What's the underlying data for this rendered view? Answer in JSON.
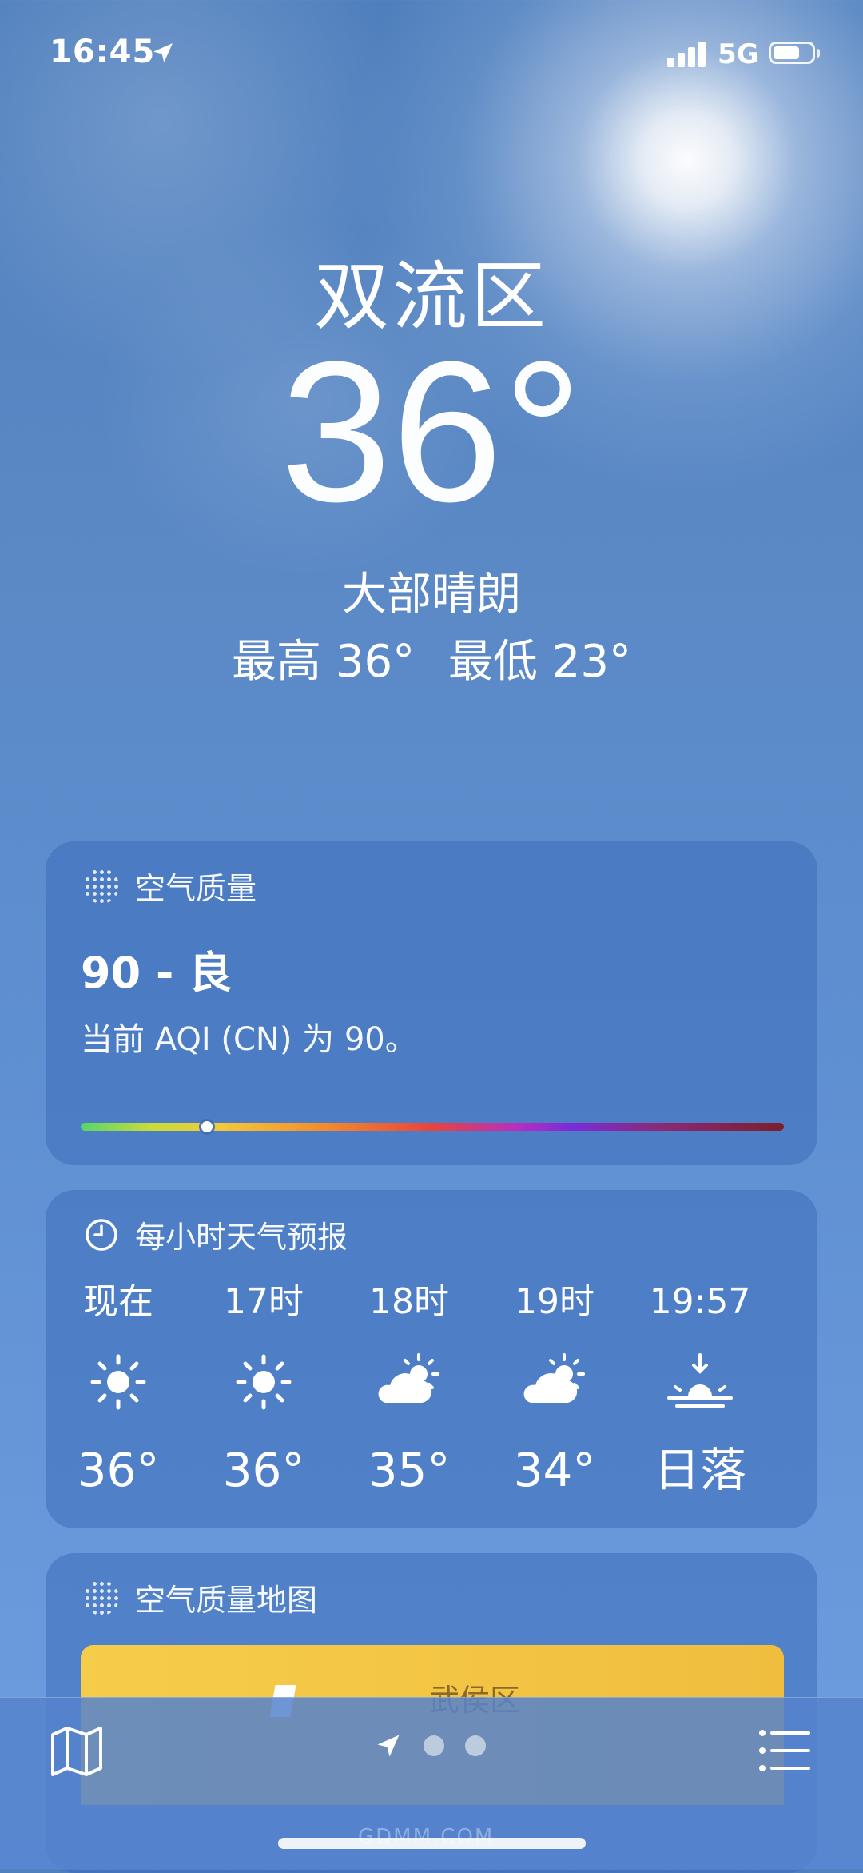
{
  "status_bar": {
    "time": "16:45",
    "network": "5G",
    "battery_level": 0.7
  },
  "weather": {
    "location": "双流区",
    "temperature": "36°",
    "condition": "大部晴朗",
    "high": "最高 36°",
    "low": "最低 23°"
  },
  "air_quality": {
    "title": "空气质量",
    "value": "90 - 良",
    "description": "当前 AQI (CN) 为 90。",
    "scale_position": 0.18
  },
  "hourly": {
    "title": "每小时天气预报",
    "items": [
      {
        "time": "现在",
        "icon": "sun-icon",
        "value": "36°"
      },
      {
        "time": "17时",
        "icon": "sun-icon",
        "value": "36°"
      },
      {
        "time": "18时",
        "icon": "partly-cloudy-icon",
        "value": "35°"
      },
      {
        "time": "19时",
        "icon": "partly-cloudy-icon",
        "value": "34°"
      },
      {
        "time": "19:57",
        "icon": "sunset-icon",
        "value": "日落"
      }
    ]
  },
  "aqi_map": {
    "title": "空气质量地图",
    "map_label": "武侯区"
  },
  "bottom_bar": {
    "pages": 2,
    "current_page": "location"
  },
  "watermark": "GDMM.COM",
  "colors": {
    "sky": "#5b89c6",
    "card": "#3c6eb9",
    "map_fill": "#f5cd4b"
  }
}
